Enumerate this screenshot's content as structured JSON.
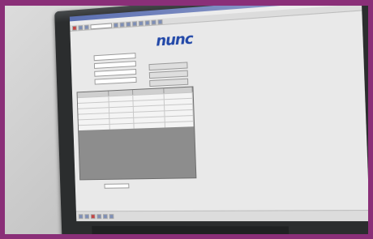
{
  "app": {
    "logo_text": "nunc"
  }
}
